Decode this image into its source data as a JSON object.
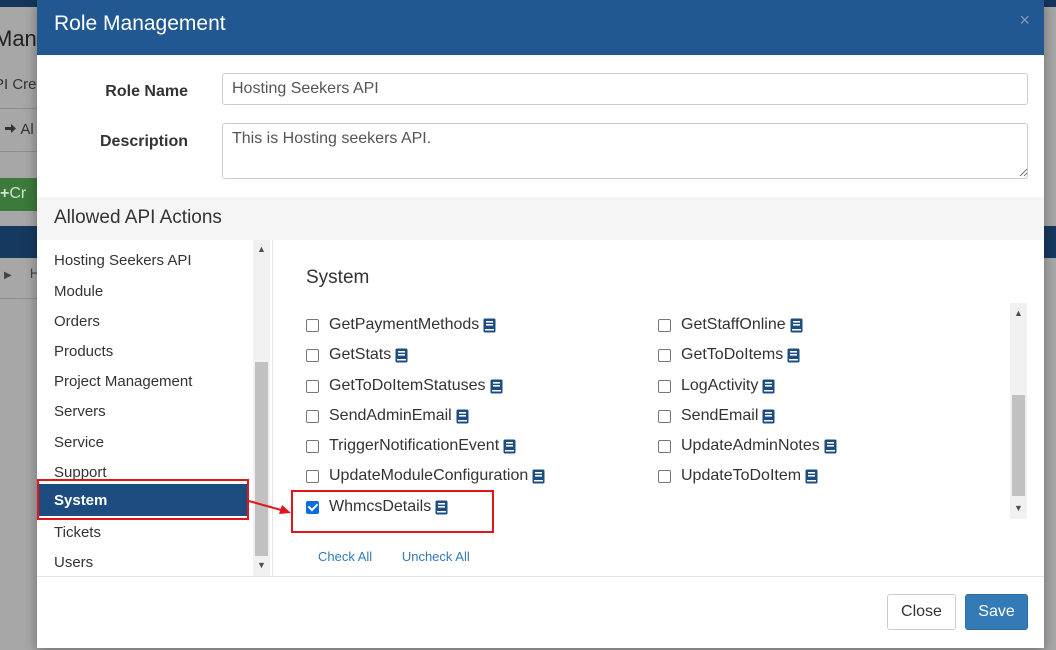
{
  "background": {
    "title": "Mana",
    "subtitle": "PI Cre",
    "tab": "Al",
    "create_button": "Cr",
    "row_text": "H"
  },
  "modal": {
    "title": "Role Management",
    "close_icon": "×"
  },
  "form": {
    "role_name_label": "Role Name",
    "role_name_value": "Hosting Seekers API",
    "description_label": "Description",
    "description_value": "This is Hosting seekers API."
  },
  "allowed": {
    "title": "Allowed API Actions",
    "categories": [
      {
        "label": "Hosting Seekers API"
      },
      {
        "label": "Module"
      },
      {
        "label": "Orders"
      },
      {
        "label": "Products"
      },
      {
        "label": "Project Management"
      },
      {
        "label": "Servers"
      },
      {
        "label": "Service"
      },
      {
        "label": "Support"
      },
      {
        "label": "System",
        "active": true
      },
      {
        "label": "Tickets"
      },
      {
        "label": "Users"
      }
    ],
    "section_title": "System",
    "actions": [
      {
        "label": "GetPaymentMethods",
        "checked": false
      },
      {
        "label": "GetStaffOnline",
        "checked": false
      },
      {
        "label": "GetStats",
        "checked": false
      },
      {
        "label": "GetToDoItems",
        "checked": false
      },
      {
        "label": "GetToDoItemStatuses",
        "checked": false
      },
      {
        "label": "LogActivity",
        "checked": false
      },
      {
        "label": "SendAdminEmail",
        "checked": false
      },
      {
        "label": "SendEmail",
        "checked": false
      },
      {
        "label": "TriggerNotificationEvent",
        "checked": false
      },
      {
        "label": "UpdateAdminNotes",
        "checked": false
      },
      {
        "label": "UpdateModuleConfiguration",
        "checked": false
      },
      {
        "label": "UpdateToDoItem",
        "checked": false
      },
      {
        "label": "WhmcsDetails",
        "checked": true
      }
    ],
    "check_all": "Check All",
    "uncheck_all": "Uncheck All"
  },
  "footer": {
    "close_label": "Close",
    "save_label": "Save"
  },
  "colors": {
    "header": "#225892",
    "active_category": "#1d4c80",
    "save_button": "#337ab7",
    "annotation": "#e3151a"
  }
}
